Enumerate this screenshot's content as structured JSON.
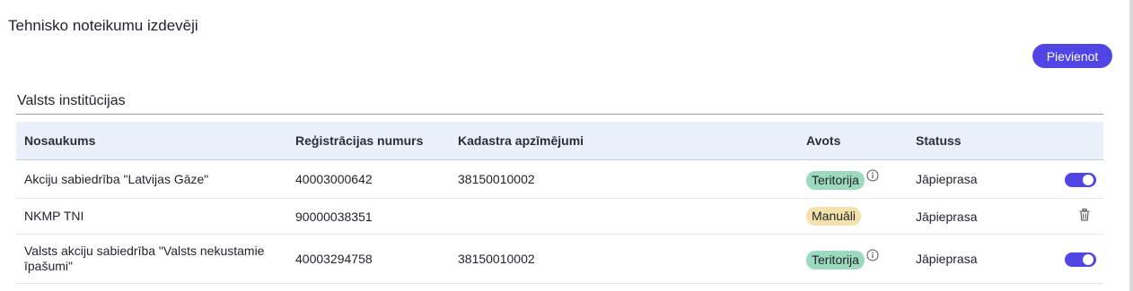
{
  "page": {
    "title": "Tehnisko noteikumu izdevēji"
  },
  "toolbar": {
    "add_label": "Pievienot"
  },
  "section": {
    "title": "Valsts institūcijas"
  },
  "table": {
    "columns": [
      "Nosaukums",
      "Reģistrācijas numurs",
      "Kadastra apzīmējumi",
      "Avots",
      "Statuss"
    ],
    "rows": [
      {
        "name": "Akciju sabiedrība \"Latvijas Gāze\"",
        "reg_no": "40003000642",
        "cadastre": "38150010002",
        "source": "Teritorija",
        "source_color": "#9dd9bf",
        "status": "Jāpieprasa",
        "action": "toggle-on"
      },
      {
        "name": "NKMP TNI",
        "reg_no": "90000038351",
        "cadastre": "",
        "source": "Manuāli",
        "source_color": "#f3e2ab",
        "status": "Jāpieprasa",
        "action": "trash-icon"
      },
      {
        "name": "Valsts akciju sabiedrība \"Valsts nekustamie īpašumi\"",
        "reg_no": "40003294758",
        "cadastre": "38150010002",
        "source": "Teritorija",
        "source_color": "#9dd9bf",
        "status": "Jāpieprasa",
        "action": "toggle-on"
      }
    ]
  },
  "colors": {
    "accent": "#5146e5",
    "header_bg": "#eaf1fb"
  }
}
